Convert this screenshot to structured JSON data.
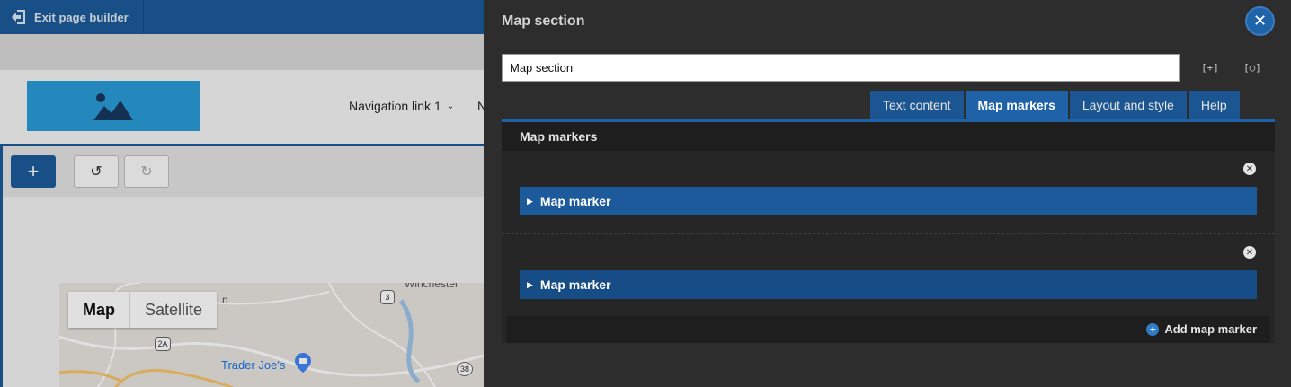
{
  "builder": {
    "exit_label": "Exit page builder",
    "nav_link_1": "Navigation link 1",
    "nav_link_2_partial": "N",
    "add_symbol": "+",
    "undo_symbol": "↺",
    "redo_symbol": "↻"
  },
  "map": {
    "type_map": "Map",
    "type_satellite": "Satellite",
    "place_winchester": "Winchester",
    "place_partial": "n",
    "poi": "Trader Joe's",
    "shield_3": "3",
    "shield_2a": "2A",
    "shield_38": "38"
  },
  "panel": {
    "title": "Map section",
    "close_symbol": "✕",
    "name_value": "Map section",
    "expand_label": "[+]",
    "collapse_label": "[○]",
    "tabs": [
      {
        "label": "Text content"
      },
      {
        "label": "Map markers"
      },
      {
        "label": "Layout and style"
      },
      {
        "label": "Help"
      }
    ],
    "active_tab": "Map markers",
    "section_title": "Map markers",
    "markers": [
      {
        "label": "Map marker"
      },
      {
        "label": "Map marker"
      }
    ],
    "remove_symbol": "✕",
    "add_marker_label": "Add map marker",
    "add_marker_symbol": "+"
  },
  "colors": {
    "accent_blue": "#1f62a7",
    "panel_bg": "#2d2d2d",
    "marker_bar": "#1c5a9b"
  }
}
